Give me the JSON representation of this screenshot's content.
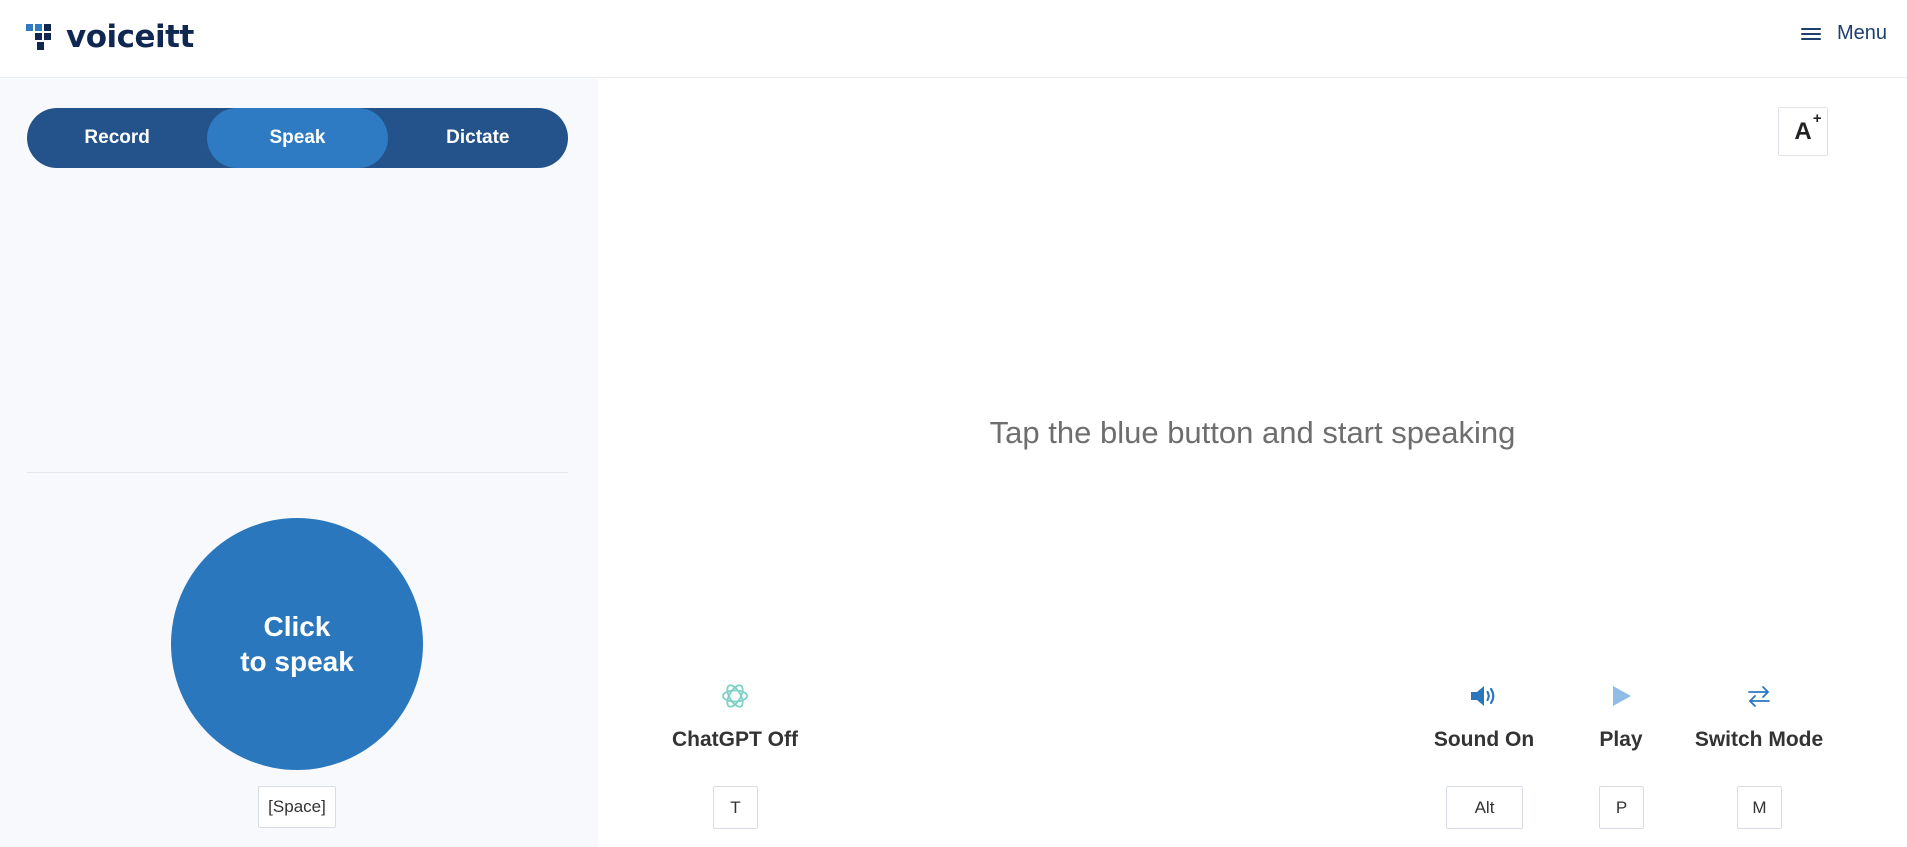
{
  "header": {
    "logo_text": "voiceitt",
    "menu_label": "Menu"
  },
  "modes": {
    "tabs": [
      "Record",
      "Speak",
      "Dictate"
    ],
    "active": "Speak"
  },
  "speak_button": {
    "line1": "Click",
    "line2": "to speak",
    "shortcut": "[Space]"
  },
  "font_size_button": {
    "letter": "A",
    "sign": "+"
  },
  "main": {
    "prompt": "Tap the blue button and start speaking"
  },
  "controls": {
    "chatgpt": {
      "label": "ChatGPT Off",
      "key": "T",
      "icon": "chatgpt-icon"
    },
    "sound": {
      "label": "Sound On",
      "key": "Alt",
      "icon": "speaker-icon"
    },
    "play": {
      "label": "Play",
      "key": "P",
      "icon": "play-icon"
    },
    "switch_mode": {
      "label": "Switch Mode",
      "key": "M",
      "icon": "switch-arrows-icon"
    }
  },
  "colors": {
    "brand_dark": "#0f2751",
    "switch_bg": "#23538a",
    "switch_active": "#2f7bc3",
    "speak_button": "#2b77bd",
    "chatgpt_icon": "#7fd1c6"
  }
}
